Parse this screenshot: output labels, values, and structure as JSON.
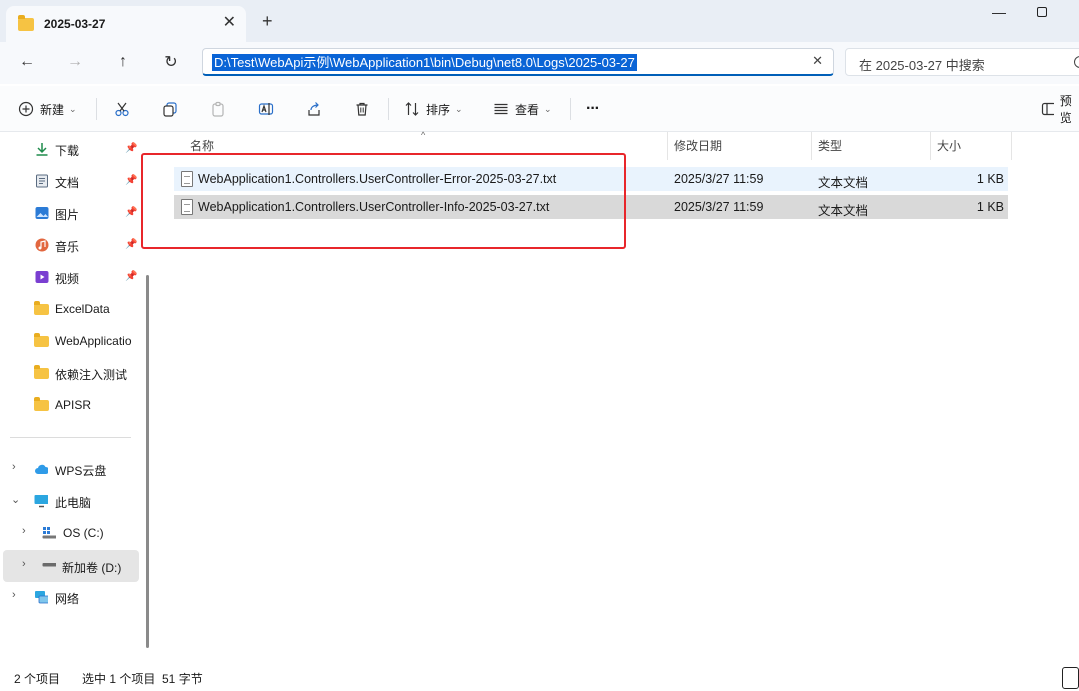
{
  "tab": {
    "title": "2025-03-27",
    "close": "✕",
    "new": "+"
  },
  "window": {
    "minimize": "—"
  },
  "nav": {
    "back": "←",
    "forward": "→",
    "up": "↑",
    "refresh": "↻"
  },
  "address": {
    "path": "D:\\Test\\WebApi示例\\WebApplication1\\bin\\Debug\\net8.0\\Logs\\2025-03-27",
    "clear": "✕"
  },
  "search": {
    "placeholder": "在 2025-03-27 中搜索"
  },
  "toolbar": {
    "new_label": "新建",
    "sort_label": "排序",
    "view_label": "查看",
    "more": "···",
    "preview_label": "预览",
    "dropdown": "⌄"
  },
  "sidebar": {
    "quick_access": [
      {
        "label": "下载",
        "icon": "download-icon",
        "pinned": true
      },
      {
        "label": "文档",
        "icon": "document-icon",
        "pinned": true
      },
      {
        "label": "图片",
        "icon": "pictures-icon",
        "pinned": true
      },
      {
        "label": "音乐",
        "icon": "music-icon",
        "pinned": true
      },
      {
        "label": "视频",
        "icon": "video-icon",
        "pinned": true
      },
      {
        "label": "ExcelData",
        "icon": "folder-icon",
        "pinned": false
      },
      {
        "label": "WebApplicatio",
        "icon": "folder-icon",
        "pinned": false
      },
      {
        "label": "依赖注入测试",
        "icon": "folder-icon",
        "pinned": false
      },
      {
        "label": "APISR",
        "icon": "folder-icon",
        "pinned": false
      }
    ],
    "pin_glyph": "📌",
    "tree": [
      {
        "label": "WPS云盘",
        "icon": "cloud-icon",
        "expanded": false
      },
      {
        "label": "此电脑",
        "icon": "computer-icon",
        "expanded": true
      },
      {
        "label": "OS (C:)",
        "icon": "windows-drive-icon",
        "expanded": false
      },
      {
        "label": "新加卷 (D:)",
        "icon": "drive-icon",
        "expanded": false,
        "selected": true
      },
      {
        "label": "网络",
        "icon": "network-icon",
        "expanded": false
      }
    ],
    "chev_right": "›",
    "chev_down": "⌄"
  },
  "columns": {
    "name": "名称",
    "modified": "修改日期",
    "type": "类型",
    "size": "大小",
    "sort_indicator": "^"
  },
  "files": [
    {
      "name": "WebApplication1.Controllers.UserController-Error-2025-03-27.txt",
      "modified": "2025/3/27 11:59",
      "type": "文本文档",
      "size": "1 KB",
      "state": "hover"
    },
    {
      "name": "WebApplication1.Controllers.UserController-Info-2025-03-27.txt",
      "modified": "2025/3/27 11:59",
      "type": "文本文档",
      "size": "1 KB",
      "state": "selected"
    }
  ],
  "status": {
    "item_count": "2 个项目",
    "selection": "选中 1 个项目  51 字节"
  },
  "colors": {
    "accent": "#005fb8",
    "annotation": "#e8262b",
    "folder": "#f6c343"
  }
}
